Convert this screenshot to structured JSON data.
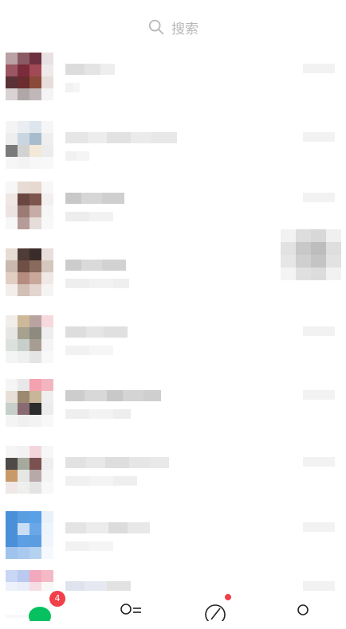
{
  "search": {
    "placeholder": "搜索"
  },
  "chats": [
    {
      "avatar": [
        "#b9a1a4",
        "#8a5a63",
        "#6d3040",
        "#e8e0e2",
        "#9c5563",
        "#7b2c3a",
        "#a14a55",
        "#efe9ea",
        "#5a3136",
        "#6a2c2e",
        "#8a4a3a",
        "#e7dddd",
        "#d9d3d3",
        "#b0a8a8",
        "#c0b8b8",
        "#f5f3f3"
      ],
      "name": [
        "#dcdcdc",
        "#e4e4e4",
        "#eeeeee"
      ],
      "preview": [
        "#f2f2f2",
        "#f6f6f6"
      ]
    },
    {
      "avatar": [
        "#f4f4f4",
        "#eaeef2",
        "#dde6ee",
        "#f6f6f6",
        "#eeeeee",
        "#c9d6e1",
        "#a7bccd",
        "#efefef",
        "#7a7a7a",
        "#d2d2d2",
        "#f3e9d8",
        "#ececec",
        "#f6f6f6",
        "#f3f3f3",
        "#f7f7f7",
        "#f8f8f8"
      ],
      "name": [
        "#e6e6e6",
        "#ededed",
        "#e2e2e2",
        "#ebebeb",
        "#e8e8e8"
      ],
      "preview": [
        "#f1f1f1",
        "#f5f5f5"
      ]
    },
    {
      "avatar": [
        "#f7f7f7",
        "#e8dbd5",
        "#e7d8d0",
        "#f7f7f7",
        "#efe7e4",
        "#6a4641",
        "#7d544e",
        "#f2efee",
        "#ece4e1",
        "#9b7b75",
        "#c7aca6",
        "#f6f6f6",
        "#f7f7f7",
        "#b59c98",
        "#e6dcda",
        "#f8f8f8"
      ],
      "name": [
        "#c8c8c8",
        "#d6d6d6",
        "#cfcfcf"
      ],
      "preview": [
        "#ededed",
        "#f2f2f2"
      ]
    },
    {
      "avatar": [
        "#e6dcd4",
        "#4f3b37",
        "#3b2c29",
        "#e8dfdb",
        "#c9b9ae",
        "#6e5046",
        "#8b6a5e",
        "#d6c7be",
        "#e2cfc3",
        "#b58c80",
        "#caa79b",
        "#efe8e4",
        "#f3eeeb",
        "#d2bfb6",
        "#e3d5cf",
        "#f6f4f3"
      ],
      "name": [
        "#cccccc",
        "#dadada",
        "#d2d2d2"
      ],
      "preview": [
        "#eeeeee",
        "#f2f2f2",
        "#efefef"
      ]
    },
    {
      "avatar": [
        "#f1eee9",
        "#cdb89a",
        "#b8a3a0",
        "#f6d8de",
        "#e6e6e4",
        "#a6a28f",
        "#8f8a80",
        "#eeeeee",
        "#dbe2de",
        "#c8cfcb",
        "#a89d92",
        "#f4f4f4",
        "#f3f4f4",
        "#eef0ef",
        "#e4e4e4",
        "#f8f8f8"
      ],
      "name": [
        "#dddddd",
        "#e6e6e6",
        "#e0e0e0"
      ],
      "preview": [
        "#f2f2f2",
        "#f6f6f6"
      ]
    },
    {
      "avatar": [
        "#f5f5f5",
        "#e8e8e8",
        "#f4a1b0",
        "#f3b6c0",
        "#e6e0d8",
        "#9b8a70",
        "#c9b59a",
        "#efefef",
        "#c6cfc9",
        "#8a6a72",
        "#2c2c2c",
        "#ececec",
        "#f4f4f4",
        "#f0f0f0",
        "#f3f3f3",
        "#f8f8f8"
      ],
      "name": [
        "#cdcdcd",
        "#d8d8d8",
        "#c8c8c8",
        "#d4d4d4",
        "#cfcfcf"
      ],
      "preview": [
        "#efefef",
        "#f3f3f3",
        "#eeeeee"
      ]
    },
    {
      "avatar": [
        "#f5f5f5",
        "#f2f2f2",
        "#f3d6dc",
        "#f7f7f7",
        "#4d4a48",
        "#a6aa9c",
        "#7a5050",
        "#efefef",
        "#c89a6a",
        "#e6e6e4",
        "#b8a8a8",
        "#f4f4f4",
        "#f0e8e6",
        "#eef0ee",
        "#e4e4e4",
        "#f8f8f8"
      ],
      "name": [
        "#e2e2e2",
        "#e8e8e8",
        "#dedede",
        "#e6e6e6",
        "#e9e9e9"
      ],
      "preview": [
        "#f0f0f0",
        "#f4f4f4",
        "#efefef"
      ]
    },
    {
      "avatar": [
        "#4a90d9",
        "#5a9ee2",
        "#5aa0e6",
        "#e9f1fa",
        "#4b8fd8",
        "#c9def4",
        "#6aa7e8",
        "#eef4fb",
        "#4a8fd7",
        "#5c9fe4",
        "#5b9de0",
        "#f0f5fb",
        "#9ec3ec",
        "#a9c9ee",
        "#b5d1f0",
        "#f5f8fc"
      ],
      "name": [
        "#e4e4e4",
        "#ececec",
        "#dcdcdc",
        "#e8e8e8"
      ],
      "preview": [
        "#f2f2f2",
        "#f5f5f5"
      ]
    },
    {
      "avatar": [
        "#c9d6f4",
        "#b9c9f0",
        "#f2a9bd",
        "#f5b9c6",
        "#eef2fb",
        "#e9eefa",
        "#f6dde3",
        "#f8f8f8",
        "#f8f8f8",
        "#f8f8f8",
        "#f8f8f8",
        "#f8f8f8",
        "#f8f8f8",
        "#f8f8f8",
        "#f8f8f8",
        "#f8f8f8"
      ],
      "name": [
        "#dfe3ee",
        "#e6e9f1",
        "#e2e2e2"
      ],
      "preview": [
        "#f4f4f4",
        "#f7f7f7"
      ]
    }
  ],
  "sticker": [
    "#f2f2f2",
    "#dddddd",
    "#d8d8d8",
    "#f0f0f0",
    "#e2e2e2",
    "#c8c8c8",
    "#bdbdbd",
    "#dedede",
    "#e6e6e6",
    "#cfcfcf",
    "#c4c4c4",
    "#e2e2e2",
    "#f4f4f4",
    "#e0e0e0",
    "#dcdcdc",
    "#f2f2f2"
  ],
  "tabbar": {
    "chats_badge": "4",
    "accent": "#07c160",
    "badge_color": "#f0404a"
  }
}
